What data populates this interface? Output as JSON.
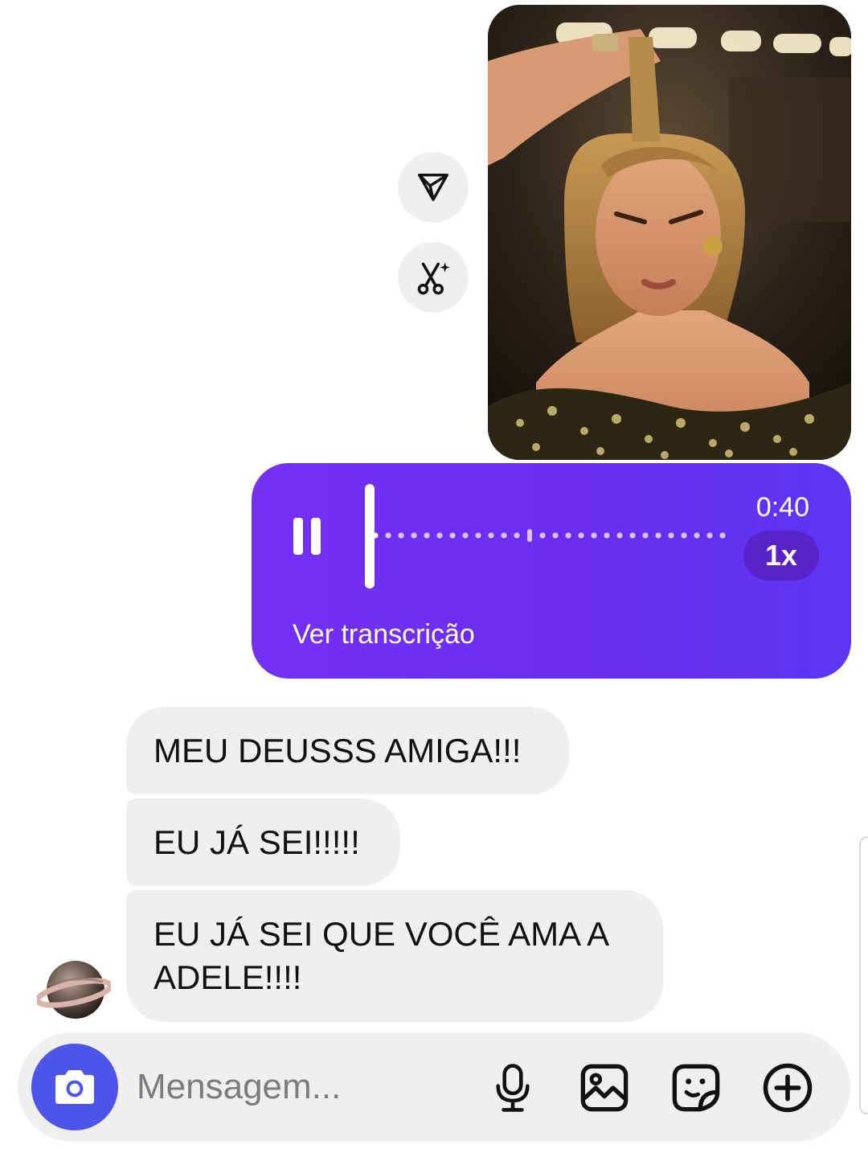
{
  "thread": {
    "photo": {
      "alt": ""
    },
    "actions": [
      {
        "icon": "share-icon"
      },
      {
        "icon": "remix-icon"
      }
    ],
    "voice_message": {
      "duration": "0:40",
      "speed": "1x",
      "transcript_link": "Ver transcrição",
      "state": "playing",
      "progress": 0.02
    },
    "received": [
      {
        "text": "MEU DEUSSS AMIGA!!!"
      },
      {
        "text": "EU JÁ SEI!!!!!"
      },
      {
        "text": "EU JÁ SEI QUE VOCÊ AMA A ADELE!!!!"
      }
    ],
    "sender_avatar": {
      "icon": "planet-avatar"
    }
  },
  "composer": {
    "placeholder": "Mensagem...",
    "icons": [
      "camera-icon",
      "microphone-icon",
      "gallery-icon",
      "sticker-icon",
      "add-icon"
    ]
  },
  "colors": {
    "voice_bubble": "#6f2ff2",
    "speed_pill": "#5a23c9",
    "camera_button": "#4d55e8",
    "received_bubble": "#efefef"
  }
}
